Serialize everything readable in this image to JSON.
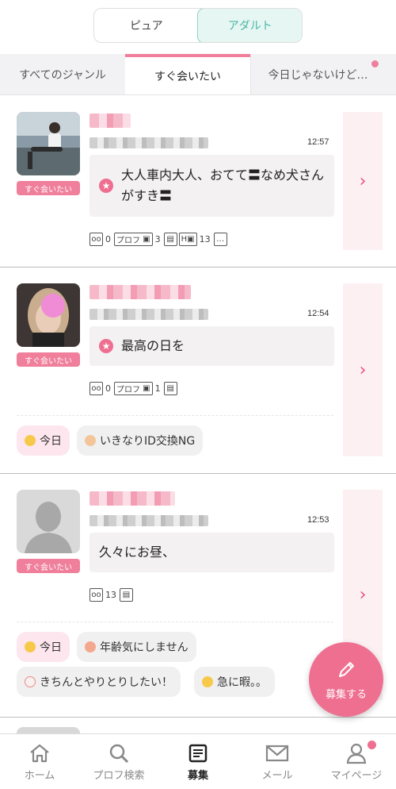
{
  "toggle": {
    "option1": "ピュア",
    "option2": "アダルト",
    "selected": "アダルト"
  },
  "tabs": {
    "items": [
      "すべてのジャンル",
      "すぐ会いたい",
      "今日じゃないけど…"
    ],
    "active": "すぐ会いたい"
  },
  "posts": [
    {
      "badge": "すぐ会いたい",
      "time": "12:57",
      "message": "大人車内大人、おてて〓なめ犬さんがすき〓",
      "stats": {
        "views": "0",
        "prof_label": "プロフ",
        "photos": "3",
        "h_photos": "13"
      }
    },
    {
      "badge": "すぐ会いたい",
      "time": "12:54",
      "message": "最高の日を",
      "stats": {
        "views": "0",
        "prof_label": "プロフ",
        "photos": "1"
      },
      "tags": [
        "今日",
        "いきなりID交換NG"
      ]
    },
    {
      "badge": "すぐ会いたい",
      "time": "12:53",
      "message": "久々にお昼、",
      "stats": {
        "views": "13"
      },
      "tags": [
        "今日",
        "年齢気にしません",
        "きちんとやりとりしたい！",
        "急に暇。。"
      ]
    }
  ],
  "fab": {
    "label": "募集する"
  },
  "bottom_nav": {
    "items": [
      "ホーム",
      "プロフ検索",
      "募集",
      "メール",
      "マイページ"
    ],
    "active": "募集"
  },
  "colors": {
    "accent_pink": "#ef6f90",
    "teal": "#4bb6a6"
  }
}
